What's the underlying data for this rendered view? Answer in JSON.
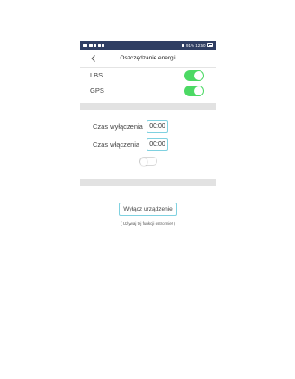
{
  "status_bar": {
    "left_text": "",
    "right_text": "91% 12:50"
  },
  "nav": {
    "title": "Oszczędzanie energii"
  },
  "toggles": [
    {
      "label": "LBS",
      "on": true
    },
    {
      "label": "GPS",
      "on": true
    }
  ],
  "schedule": {
    "off_time_label": "Czas wyłączenia",
    "off_time_value": "00:00",
    "on_time_label": "Czas włączenia",
    "on_time_value": "00:00",
    "schedule_enabled": false
  },
  "device": {
    "shutdown_button_label": "Wyłącz urządzenie",
    "warning_text": "( Używaj tej funkcji ostrożnie! )"
  },
  "colors": {
    "status_bar": "#2f3e63",
    "switch_on": "#4cd964",
    "input_border": "#7fd1e0",
    "band": "#e2e2e2"
  }
}
